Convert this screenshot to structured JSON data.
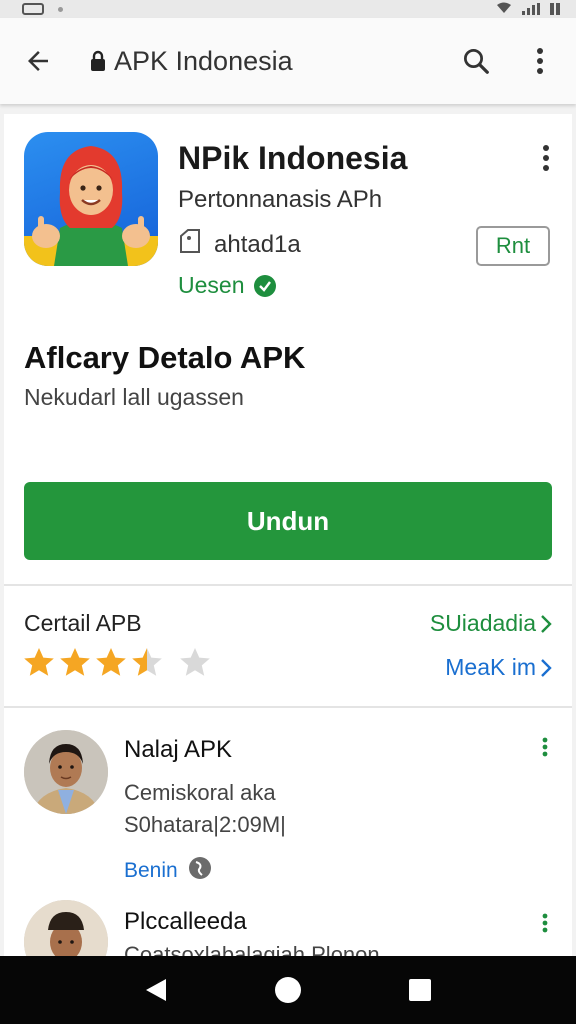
{
  "appbar": {
    "title": "APK Indonesia"
  },
  "app": {
    "name": "NPik  Indonesia",
    "developer": "Pertonnanasis APh",
    "rating_text": "ahtad1a",
    "version": "Uesen",
    "rent_label": "Rnt"
  },
  "details": {
    "title": "Aflcary Detalo APK",
    "subtitle": "Nekudarl lall ugassen"
  },
  "download": {
    "label": "Undun"
  },
  "ratings": {
    "title": "Certail APB",
    "link_green": "SUiadadia",
    "link_blue": "MeaK im",
    "stars_value": 3.5,
    "stars_max": 5
  },
  "reviews": [
    {
      "name": "Nalaj APK",
      "line1": "Cemiskoral aka",
      "line2": "S0hatara|2:09M|",
      "tag": "Benin"
    },
    {
      "name": "Plccalleeda",
      "line1": "Coatsoxlabalagiah Plonon"
    }
  ],
  "colors": {
    "accent_green": "#24963c",
    "link_blue": "#1a6fd0",
    "star_gold": "#f5a623"
  }
}
